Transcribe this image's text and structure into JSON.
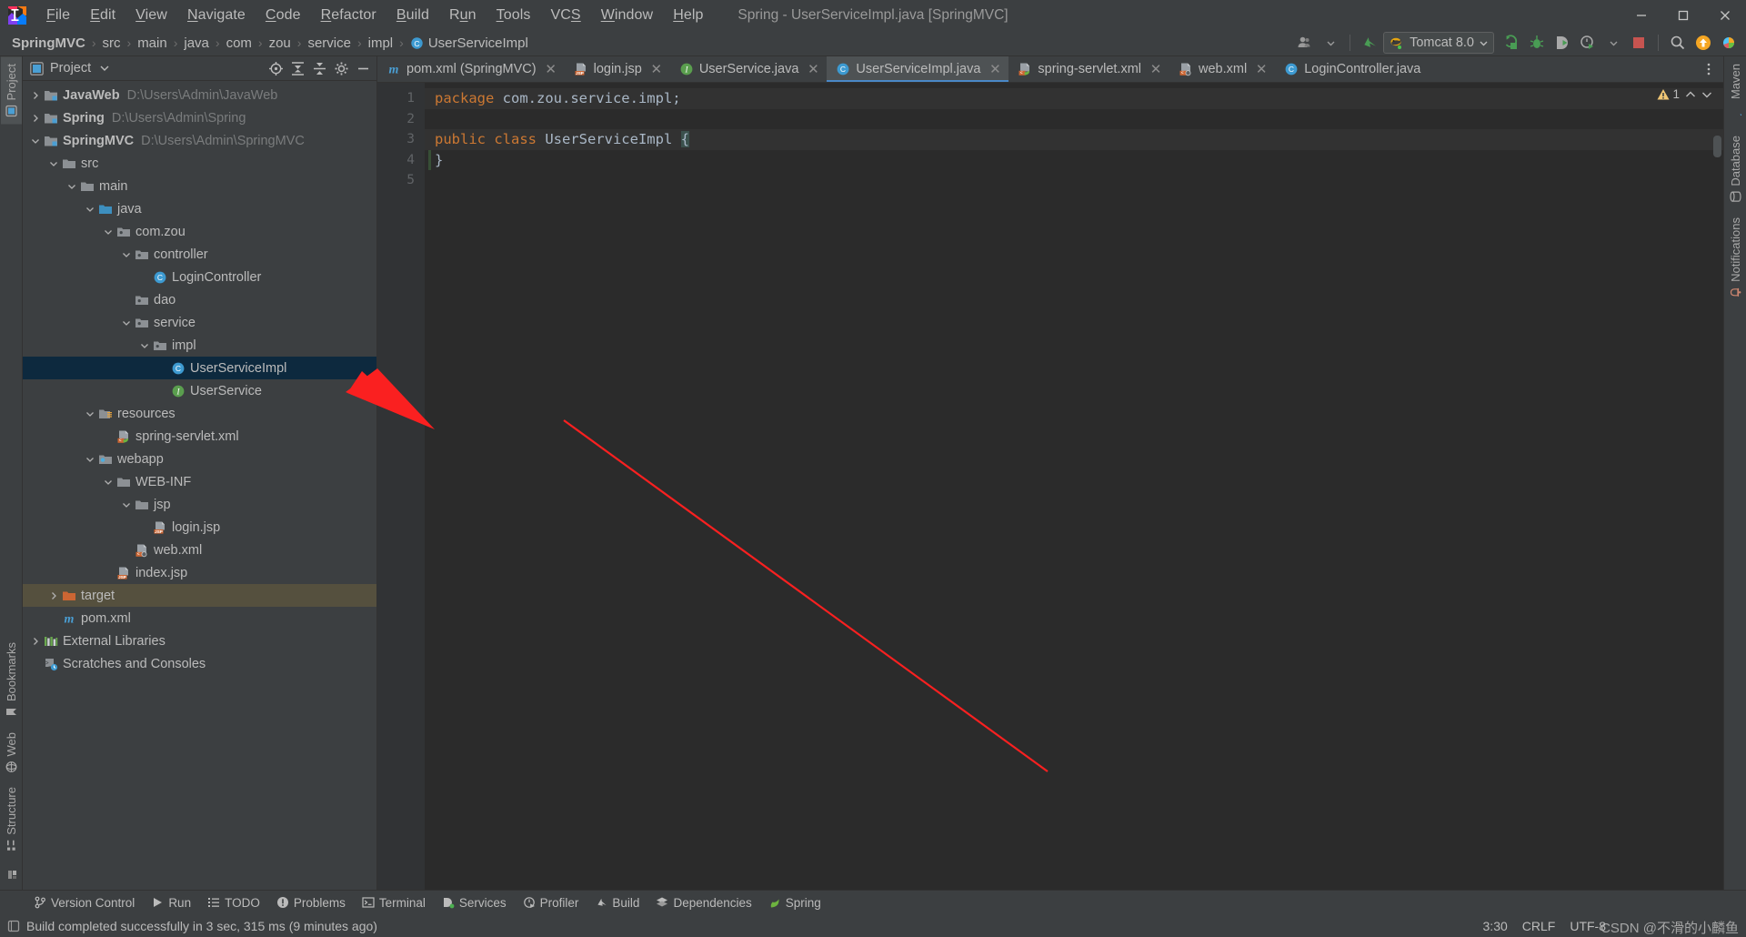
{
  "window": {
    "title": "Spring - UserServiceImpl.java [SpringMVC]",
    "minimize_label": "–",
    "maximize_label": "❐",
    "close_label": "✕"
  },
  "menubar": {
    "items": [
      {
        "label": "File",
        "mnemonic": "F"
      },
      {
        "label": "Edit",
        "mnemonic": "E"
      },
      {
        "label": "View",
        "mnemonic": "V"
      },
      {
        "label": "Navigate",
        "mnemonic": "N"
      },
      {
        "label": "Code",
        "mnemonic": "C"
      },
      {
        "label": "Refactor",
        "mnemonic": "R"
      },
      {
        "label": "Build",
        "mnemonic": "B"
      },
      {
        "label": "Run",
        "mnemonic": "u"
      },
      {
        "label": "Tools",
        "mnemonic": "T"
      },
      {
        "label": "VCS",
        "mnemonic": "S"
      },
      {
        "label": "Window",
        "mnemonic": "W"
      },
      {
        "label": "Help",
        "mnemonic": "H"
      }
    ]
  },
  "breadcrumb": {
    "items": [
      {
        "label": "SpringMVC",
        "bold": true,
        "icon": ""
      },
      {
        "label": "src",
        "bold": false,
        "icon": ""
      },
      {
        "label": "main",
        "bold": false,
        "icon": ""
      },
      {
        "label": "java",
        "bold": false,
        "icon": ""
      },
      {
        "label": "com",
        "bold": false,
        "icon": ""
      },
      {
        "label": "zou",
        "bold": false,
        "icon": ""
      },
      {
        "label": "service",
        "bold": false,
        "icon": ""
      },
      {
        "label": "impl",
        "bold": false,
        "icon": ""
      },
      {
        "label": "UserServiceImpl",
        "bold": false,
        "icon": "class-icon"
      }
    ],
    "separator": "›"
  },
  "toolbar": {
    "account_icon": "account-icon",
    "update_icon": "update-project-icon",
    "run_config": "Tomcat 8.0",
    "run_icon": "run-icon",
    "debug_icon": "debug-icon",
    "run_with_coverage_icon": "run-coverage-icon",
    "profile_icon": "profiler-icon",
    "stop_icon": "stop-icon",
    "search_icon": "search-everywhere-icon",
    "notification_icon": "update-available-icon",
    "ide_icon": "ide-feature-icon"
  },
  "project_panel": {
    "title": "Project",
    "dropdown_icon": "chevron-down-icon",
    "locate_icon": "select-opened-file-icon",
    "expand_icon": "expand-all-icon",
    "collapse_icon": "collapse-all-icon",
    "settings_icon": "gear-icon",
    "hide_icon": "hide-panel-icon",
    "tree": [
      {
        "label": "JavaWeb",
        "path": "D:\\Users\\Admin\\JavaWeb",
        "indent": 0,
        "twisty": "right",
        "icon": "module-icon",
        "bold": true,
        "state": "normal"
      },
      {
        "label": "Spring",
        "path": "D:\\Users\\Admin\\Spring",
        "indent": 0,
        "twisty": "right",
        "icon": "module-icon",
        "bold": true,
        "state": "normal"
      },
      {
        "label": "SpringMVC",
        "path": "D:\\Users\\Admin\\SpringMVC",
        "indent": 0,
        "twisty": "down",
        "icon": "module-icon",
        "bold": true,
        "state": "normal"
      },
      {
        "label": "src",
        "path": "",
        "indent": 1,
        "twisty": "down",
        "icon": "folder-icon",
        "bold": false,
        "state": "normal"
      },
      {
        "label": "main",
        "path": "",
        "indent": 2,
        "twisty": "down",
        "icon": "folder-icon",
        "bold": false,
        "state": "normal"
      },
      {
        "label": "java",
        "path": "",
        "indent": 3,
        "twisty": "down",
        "icon": "source-root-icon",
        "bold": false,
        "state": "normal"
      },
      {
        "label": "com.zou",
        "path": "",
        "indent": 4,
        "twisty": "down",
        "icon": "package-icon",
        "bold": false,
        "state": "normal"
      },
      {
        "label": "controller",
        "path": "",
        "indent": 5,
        "twisty": "down",
        "icon": "package-icon",
        "bold": false,
        "state": "normal"
      },
      {
        "label": "LoginController",
        "path": "",
        "indent": 6,
        "twisty": "none",
        "icon": "class-icon",
        "bold": false,
        "state": "normal"
      },
      {
        "label": "dao",
        "path": "",
        "indent": 5,
        "twisty": "none",
        "icon": "package-icon",
        "bold": false,
        "state": "normal"
      },
      {
        "label": "service",
        "path": "",
        "indent": 5,
        "twisty": "down",
        "icon": "package-icon",
        "bold": false,
        "state": "normal"
      },
      {
        "label": "impl",
        "path": "",
        "indent": 6,
        "twisty": "down",
        "icon": "package-icon",
        "bold": false,
        "state": "normal"
      },
      {
        "label": "UserServiceImpl",
        "path": "",
        "indent": 7,
        "twisty": "none",
        "icon": "class-icon",
        "bold": false,
        "state": "selected"
      },
      {
        "label": "UserService",
        "path": "",
        "indent": 7,
        "twisty": "none",
        "icon": "interface-icon",
        "bold": false,
        "state": "normal"
      },
      {
        "label": "resources",
        "path": "",
        "indent": 3,
        "twisty": "down",
        "icon": "resource-root-icon",
        "bold": false,
        "state": "normal"
      },
      {
        "label": "spring-servlet.xml",
        "path": "",
        "indent": 4,
        "twisty": "none",
        "icon": "spring-xml-icon",
        "bold": false,
        "state": "normal"
      },
      {
        "label": "webapp",
        "path": "",
        "indent": 3,
        "twisty": "down",
        "icon": "web-root-icon",
        "bold": false,
        "state": "normal"
      },
      {
        "label": "WEB-INF",
        "path": "",
        "indent": 4,
        "twisty": "down",
        "icon": "folder-icon",
        "bold": false,
        "state": "normal"
      },
      {
        "label": "jsp",
        "path": "",
        "indent": 5,
        "twisty": "down",
        "icon": "folder-icon",
        "bold": false,
        "state": "normal"
      },
      {
        "label": "login.jsp",
        "path": "",
        "indent": 6,
        "twisty": "none",
        "icon": "jsp-icon",
        "bold": false,
        "state": "normal"
      },
      {
        "label": "web.xml",
        "path": "",
        "indent": 5,
        "twisty": "none",
        "icon": "web-xml-icon",
        "bold": false,
        "state": "normal"
      },
      {
        "label": "index.jsp",
        "path": "",
        "indent": 4,
        "twisty": "none",
        "icon": "jsp-icon",
        "bold": false,
        "state": "normal"
      },
      {
        "label": "target",
        "path": "",
        "indent": 1,
        "twisty": "right",
        "icon": "excluded-folder-icon",
        "bold": false,
        "state": "excluded"
      },
      {
        "label": "pom.xml",
        "path": "",
        "indent": 1,
        "twisty": "none",
        "icon": "maven-icon",
        "bold": false,
        "state": "normal"
      },
      {
        "label": "External Libraries",
        "path": "",
        "indent": 0,
        "twisty": "right",
        "icon": "libraries-icon",
        "bold": false,
        "state": "normal"
      },
      {
        "label": "Scratches and Consoles",
        "path": "",
        "indent": 0,
        "twisty": "none",
        "icon": "scratches-icon",
        "bold": false,
        "state": "normal"
      }
    ]
  },
  "editor_tabs": [
    {
      "label": "pom.xml (SpringMVC)",
      "icon": "maven-icon",
      "active": false,
      "close": "✕"
    },
    {
      "label": "login.jsp",
      "icon": "jsp-icon",
      "active": false,
      "close": "✕"
    },
    {
      "label": "UserService.java",
      "icon": "interface-icon",
      "active": false,
      "close": "✕"
    },
    {
      "label": "UserServiceImpl.java",
      "icon": "class-icon",
      "active": true,
      "close": "✕"
    },
    {
      "label": "spring-servlet.xml",
      "icon": "spring-xml-icon",
      "active": false,
      "close": "✕"
    },
    {
      "label": "web.xml",
      "icon": "web-xml-icon",
      "active": false,
      "close": "✕"
    },
    {
      "label": "LoginController.java",
      "icon": "class-icon",
      "active": false,
      "close": ""
    }
  ],
  "editor": {
    "line_numbers": [
      "1",
      "2",
      "3",
      "4",
      "5"
    ],
    "lines": [
      {
        "num": "1",
        "highlight": true,
        "changed": true,
        "tokens": [
          {
            "text": "package",
            "type": "kw"
          },
          {
            "text": " com.zou.service.impl;",
            "type": "plain"
          }
        ]
      },
      {
        "num": "2",
        "highlight": false,
        "changed": false,
        "tokens": []
      },
      {
        "num": "3",
        "highlight": true,
        "changed": true,
        "tokens": [
          {
            "text": "public class",
            "type": "kw"
          },
          {
            "text": " UserServiceImpl ",
            "type": "cls"
          },
          {
            "text": "{",
            "type": "caret"
          }
        ]
      },
      {
        "num": "4",
        "highlight": false,
        "changed": true,
        "tokens": [
          {
            "text": "}",
            "type": "brace"
          }
        ]
      },
      {
        "num": "5",
        "highlight": false,
        "changed": false,
        "tokens": []
      }
    ],
    "inspection_count": "1",
    "inspection_icon": "warning-icon",
    "chevron_up_icon": "chevron-up-icon",
    "chevron_down_icon": "chevron-down-icon"
  },
  "left_rail": {
    "top": [
      {
        "label": "Project",
        "icon": "project-icon",
        "active": true
      }
    ],
    "bottom": [
      {
        "label": "Bookmarks",
        "icon": "bookmark-icon",
        "active": false
      },
      {
        "label": "Web",
        "icon": "web-icon",
        "active": false
      },
      {
        "label": "Structure",
        "icon": "structure-icon",
        "active": false
      }
    ]
  },
  "right_rail": {
    "items": [
      {
        "label": "Maven",
        "icon": "maven-icon"
      },
      {
        "label": "Database",
        "icon": "database-icon"
      },
      {
        "label": "Notifications",
        "icon": "notifications-icon"
      }
    ]
  },
  "tool_windows": [
    {
      "label": "Version Control",
      "icon": "branch-icon"
    },
    {
      "label": "Run",
      "icon": "run-icon"
    },
    {
      "label": "TODO",
      "icon": "todo-icon"
    },
    {
      "label": "Problems",
      "icon": "problems-icon"
    },
    {
      "label": "Terminal",
      "icon": "terminal-icon"
    },
    {
      "label": "Services",
      "icon": "services-icon"
    },
    {
      "label": "Profiler",
      "icon": "profiler-icon"
    },
    {
      "label": "Build",
      "icon": "build-icon"
    },
    {
      "label": "Dependencies",
      "icon": "dependencies-icon"
    },
    {
      "label": "Spring",
      "icon": "spring-icon"
    }
  ],
  "status_bar": {
    "message": "Build completed successfully in 3 sec, 315 ms (9 minutes ago)",
    "message_icon": "build-status-icon",
    "caret_position": "3:30",
    "line_separator": "CRLF",
    "encoding": "UTF-8",
    "watermark": "CSDN @不滑的小麟鱼"
  },
  "colors": {
    "accent_blue": "#4a88c7",
    "selection_blue": "#0d293e",
    "excluded_yellow": "#55503e",
    "panel_bg": "#3c3f41",
    "editor_bg": "#2b2b2b",
    "keyword_orange": "#cc7832",
    "arrow_red": "#fa2020"
  }
}
